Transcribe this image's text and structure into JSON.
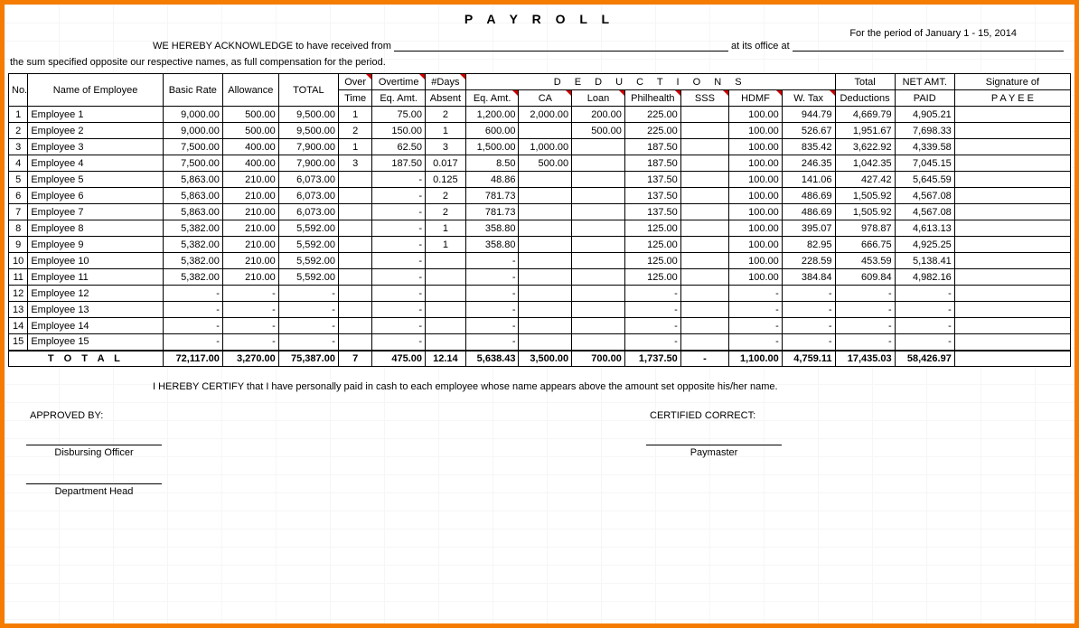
{
  "title": "P A Y R O L L",
  "period_prefix": "For the period of",
  "period_value": "January 1 - 15,  2014",
  "ack_prefix": "WE HEREBY ACKNOWLEDGE to have received from",
  "ack_mid": "at its office at",
  "sum_line": "the sum specified opposite our respective names, as full compensation for the period.",
  "headers": {
    "no": "No.",
    "name": "Name of Employee",
    "basic": "Basic Rate",
    "allow": "Allowance",
    "total": "TOTAL",
    "over": "Over",
    "overtime": "Overtime",
    "days": "#Days",
    "time": "Time",
    "eqamt": "Eq. Amt.",
    "absent": "Absent",
    "deductions": "D E D U C T I O N S",
    "ca": "CA",
    "loan": "Loan",
    "philhealth": "Philhealth",
    "sss": "SSS",
    "hdmf": "HDMF",
    "wtax": "W. Tax",
    "totded": "Total",
    "totded2": "Deductions",
    "netamt": "NET AMT.",
    "paid": "PAID",
    "sig": "Signature of",
    "payee": "P A Y E E"
  },
  "rows": [
    {
      "no": "1",
      "name": "Employee 1",
      "basic": "9,000.00",
      "allow": "500.00",
      "total": "9,500.00",
      "ot_time": "1",
      "ot_eq": "75.00",
      "absent": "2",
      "ded_eq": "1,200.00",
      "ca": "2,000.00",
      "loan": "200.00",
      "phil": "225.00",
      "sss": "",
      "hdmf": "100.00",
      "wtax": "944.79",
      "totded": "4,669.79",
      "net": "4,905.21"
    },
    {
      "no": "2",
      "name": "Employee 2",
      "basic": "9,000.00",
      "allow": "500.00",
      "total": "9,500.00",
      "ot_time": "2",
      "ot_eq": "150.00",
      "absent": "1",
      "ded_eq": "600.00",
      "ca": "",
      "loan": "500.00",
      "phil": "225.00",
      "sss": "",
      "hdmf": "100.00",
      "wtax": "526.67",
      "totded": "1,951.67",
      "net": "7,698.33"
    },
    {
      "no": "3",
      "name": "Employee 3",
      "basic": "7,500.00",
      "allow": "400.00",
      "total": "7,900.00",
      "ot_time": "1",
      "ot_eq": "62.50",
      "absent": "3",
      "ded_eq": "1,500.00",
      "ca": "1,000.00",
      "loan": "",
      "phil": "187.50",
      "sss": "",
      "hdmf": "100.00",
      "wtax": "835.42",
      "totded": "3,622.92",
      "net": "4,339.58"
    },
    {
      "no": "4",
      "name": "Employee 4",
      "basic": "7,500.00",
      "allow": "400.00",
      "total": "7,900.00",
      "ot_time": "3",
      "ot_eq": "187.50",
      "absent": "0.017",
      "ded_eq": "8.50",
      "ca": "500.00",
      "loan": "",
      "phil": "187.50",
      "sss": "",
      "hdmf": "100.00",
      "wtax": "246.35",
      "totded": "1,042.35",
      "net": "7,045.15"
    },
    {
      "no": "5",
      "name": "Employee 5",
      "basic": "5,863.00",
      "allow": "210.00",
      "total": "6,073.00",
      "ot_time": "",
      "ot_eq": "-",
      "absent": "0.125",
      "ded_eq": "48.86",
      "ca": "",
      "loan": "",
      "phil": "137.50",
      "sss": "",
      "hdmf": "100.00",
      "wtax": "141.06",
      "totded": "427.42",
      "net": "5,645.59"
    },
    {
      "no": "6",
      "name": "Employee 6",
      "basic": "5,863.00",
      "allow": "210.00",
      "total": "6,073.00",
      "ot_time": "",
      "ot_eq": "-",
      "absent": "2",
      "ded_eq": "781.73",
      "ca": "",
      "loan": "",
      "phil": "137.50",
      "sss": "",
      "hdmf": "100.00",
      "wtax": "486.69",
      "totded": "1,505.92",
      "net": "4,567.08"
    },
    {
      "no": "7",
      "name": "Employee 7",
      "basic": "5,863.00",
      "allow": "210.00",
      "total": "6,073.00",
      "ot_time": "",
      "ot_eq": "-",
      "absent": "2",
      "ded_eq": "781.73",
      "ca": "",
      "loan": "",
      "phil": "137.50",
      "sss": "",
      "hdmf": "100.00",
      "wtax": "486.69",
      "totded": "1,505.92",
      "net": "4,567.08"
    },
    {
      "no": "8",
      "name": "Employee 8",
      "basic": "5,382.00",
      "allow": "210.00",
      "total": "5,592.00",
      "ot_time": "",
      "ot_eq": "-",
      "absent": "1",
      "ded_eq": "358.80",
      "ca": "",
      "loan": "",
      "phil": "125.00",
      "sss": "",
      "hdmf": "100.00",
      "wtax": "395.07",
      "totded": "978.87",
      "net": "4,613.13"
    },
    {
      "no": "9",
      "name": "Employee 9",
      "basic": "5,382.00",
      "allow": "210.00",
      "total": "5,592.00",
      "ot_time": "",
      "ot_eq": "-",
      "absent": "1",
      "ded_eq": "358.80",
      "ca": "",
      "loan": "",
      "phil": "125.00",
      "sss": "",
      "hdmf": "100.00",
      "wtax": "82.95",
      "totded": "666.75",
      "net": "4,925.25"
    },
    {
      "no": "10",
      "name": "Employee 10",
      "basic": "5,382.00",
      "allow": "210.00",
      "total": "5,592.00",
      "ot_time": "",
      "ot_eq": "-",
      "absent": "",
      "ded_eq": "-",
      "ca": "",
      "loan": "",
      "phil": "125.00",
      "sss": "",
      "hdmf": "100.00",
      "wtax": "228.59",
      "totded": "453.59",
      "net": "5,138.41"
    },
    {
      "no": "11",
      "name": "Employee 11",
      "basic": "5,382.00",
      "allow": "210.00",
      "total": "5,592.00",
      "ot_time": "",
      "ot_eq": "-",
      "absent": "",
      "ded_eq": "-",
      "ca": "",
      "loan": "",
      "phil": "125.00",
      "sss": "",
      "hdmf": "100.00",
      "wtax": "384.84",
      "totded": "609.84",
      "net": "4,982.16"
    },
    {
      "no": "12",
      "name": "Employee 12",
      "basic": "-",
      "allow": "-",
      "total": "-",
      "ot_time": "",
      "ot_eq": "-",
      "absent": "",
      "ded_eq": "-",
      "ca": "",
      "loan": "",
      "phil": "-",
      "sss": "",
      "hdmf": "-",
      "wtax": "-",
      "totded": "-",
      "net": "-"
    },
    {
      "no": "13",
      "name": "Employee 13",
      "basic": "-",
      "allow": "-",
      "total": "-",
      "ot_time": "",
      "ot_eq": "-",
      "absent": "",
      "ded_eq": "-",
      "ca": "",
      "loan": "",
      "phil": "-",
      "sss": "",
      "hdmf": "-",
      "wtax": "-",
      "totded": "-",
      "net": "-"
    },
    {
      "no": "14",
      "name": "Employee 14",
      "basic": "-",
      "allow": "-",
      "total": "-",
      "ot_time": "",
      "ot_eq": "-",
      "absent": "",
      "ded_eq": "-",
      "ca": "",
      "loan": "",
      "phil": "-",
      "sss": "",
      "hdmf": "-",
      "wtax": "-",
      "totded": "-",
      "net": "-"
    },
    {
      "no": "15",
      "name": "Employee 15",
      "basic": "-",
      "allow": "-",
      "total": "-",
      "ot_time": "",
      "ot_eq": "-",
      "absent": "",
      "ded_eq": "-",
      "ca": "",
      "loan": "",
      "phil": "-",
      "sss": "",
      "hdmf": "-",
      "wtax": "-",
      "totded": "-",
      "net": "-"
    }
  ],
  "totals": {
    "label": "T O T A L",
    "basic": "72,117.00",
    "allow": "3,270.00",
    "total": "75,387.00",
    "ot_time": "7",
    "ot_eq": "475.00",
    "absent": "12.14",
    "ded_eq": "5,638.43",
    "ca": "3,500.00",
    "loan": "700.00",
    "phil": "1,737.50",
    "sss": "-",
    "hdmf": "1,100.00",
    "wtax": "4,759.11",
    "totded": "17,435.03",
    "net": "58,426.97"
  },
  "certify": "I HEREBY CERTIFY  that I have personally paid in cash to each employee whose name appears above the amount set opposite his/her name.",
  "approved_by": "APPROVED BY:",
  "certified_correct": "CERTIFIED CORRECT:",
  "disbursing_officer": "Disbursing Officer",
  "paymaster": "Paymaster",
  "department_head": "Department Head"
}
